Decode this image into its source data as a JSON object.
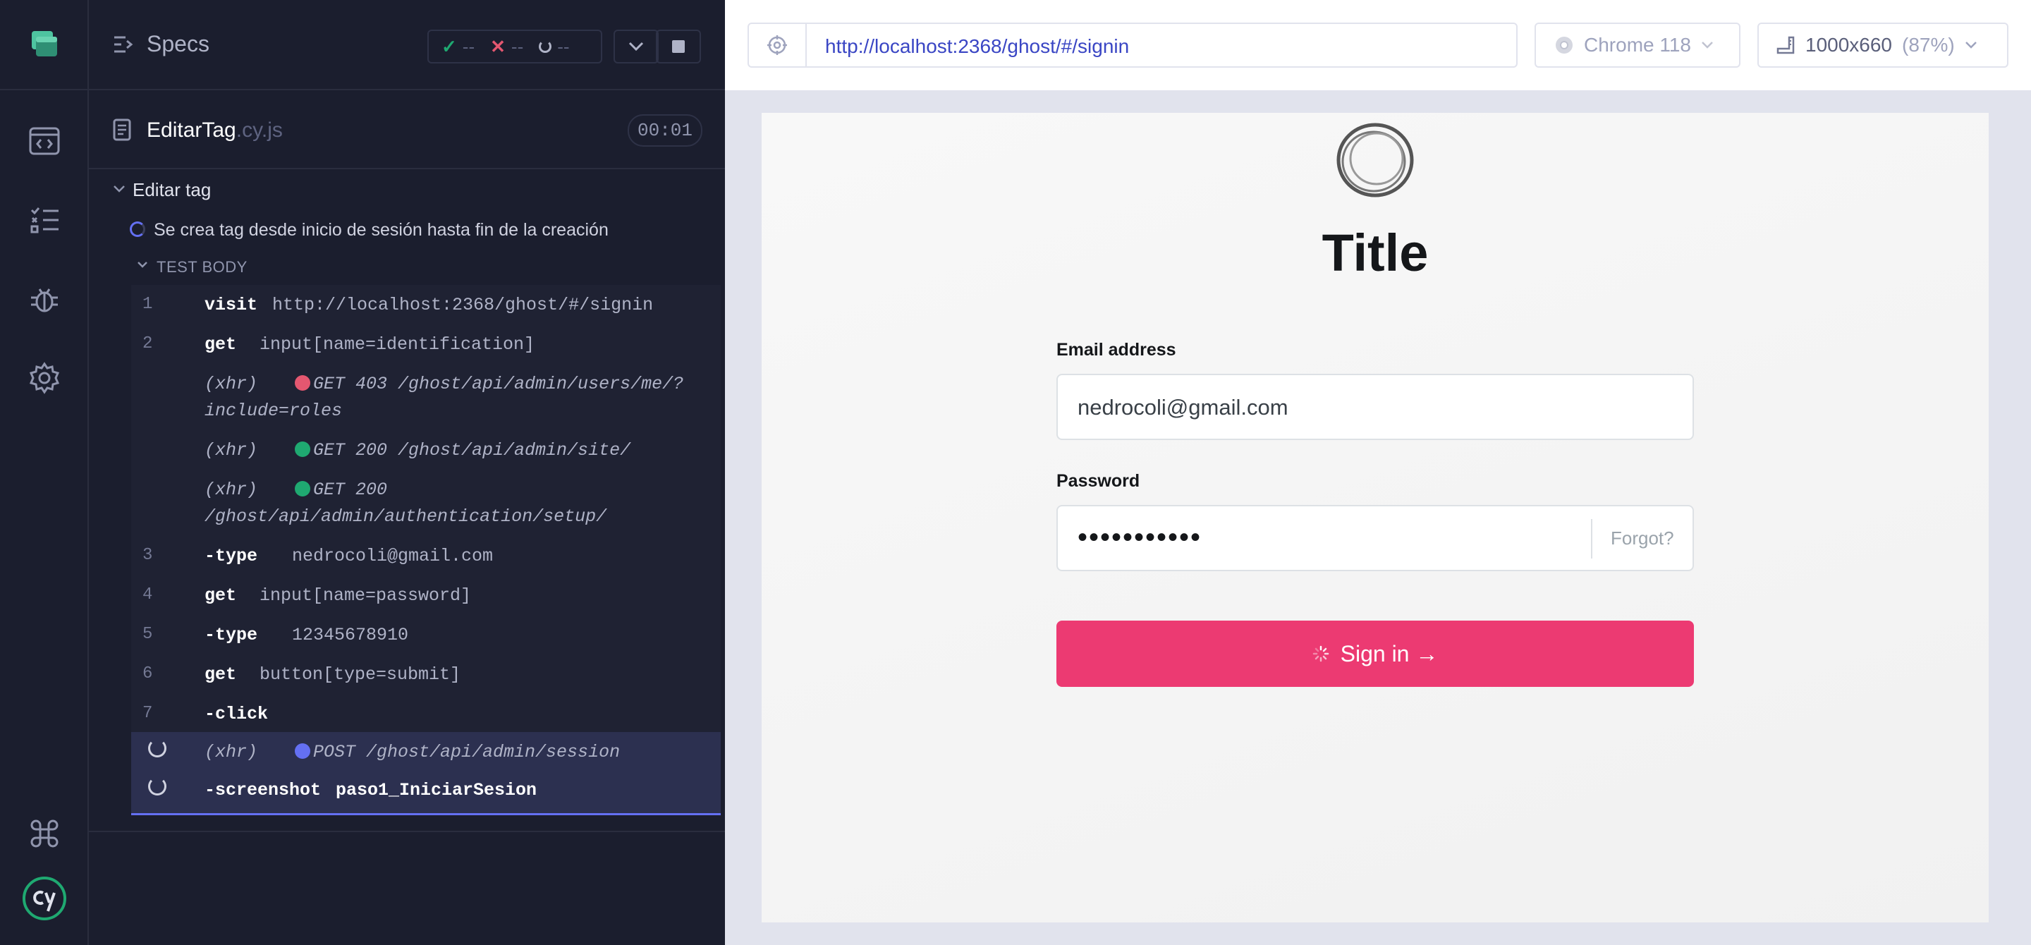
{
  "reporter": {
    "specs_label": "Specs",
    "stats": {
      "passed": "--",
      "failed": "--",
      "pending": "--"
    },
    "spec_file": {
      "name": "EditarTag",
      "ext": ".cy.js",
      "duration": "00:01"
    },
    "suite_title": "Editar tag",
    "test_title": "Se crea tag desde inicio de sesión hasta fin de la creación",
    "test_body_label": "TEST BODY",
    "commands": [
      {
        "num": "1",
        "name": "visit",
        "msg": "http://localhost:2368/ghost/#/signin"
      },
      {
        "num": "2",
        "name": "get",
        "msg": "input[name=identification]"
      },
      {
        "xhr": "(xhr)",
        "status_color": "#e45770",
        "line1": "GET 403 /ghost/api/admin/users/me/?",
        "line2": "include=roles"
      },
      {
        "xhr": "(xhr)",
        "status_color": "#1fa971",
        "line1": "GET 200 /ghost/api/admin/site/"
      },
      {
        "xhr": "(xhr)",
        "status_color": "#1fa971",
        "line1": "GET 200",
        "line2": "/ghost/api/admin/authentication/setup/"
      },
      {
        "num": "3",
        "name": "-type",
        "msg": "nedrocoli@gmail.com"
      },
      {
        "num": "4",
        "name": "get",
        "msg": "input[name=password]"
      },
      {
        "num": "5",
        "name": "-type",
        "msg": "12345678910"
      },
      {
        "num": "6",
        "name": "get",
        "msg": "button[type=submit]"
      },
      {
        "num": "7",
        "name": "-click",
        "msg": ""
      },
      {
        "xhr": "(xhr)",
        "status_color": "#6470f3",
        "line1": "POST /ghost/api/admin/session"
      },
      {
        "name": "-screenshot",
        "msg": "paso1_IniciarSesion"
      }
    ]
  },
  "topbar": {
    "url": "http://localhost:2368/ghost/#/signin",
    "browser": "Chrome 118",
    "viewport": "1000x660",
    "zoom": "(87%)"
  },
  "aut": {
    "title": "Title",
    "email_label": "Email address",
    "email_value": "nedrocoli@gmail.com",
    "password_label": "Password",
    "password_mask": "•••••••••••",
    "forgot_label": "Forgot?",
    "signin_label": "Sign in →"
  },
  "colors": {
    "accent": "#ec3a72",
    "reporter_bg": "#1b1e2e",
    "link": "#3a46c4",
    "running": "#6470f3"
  }
}
